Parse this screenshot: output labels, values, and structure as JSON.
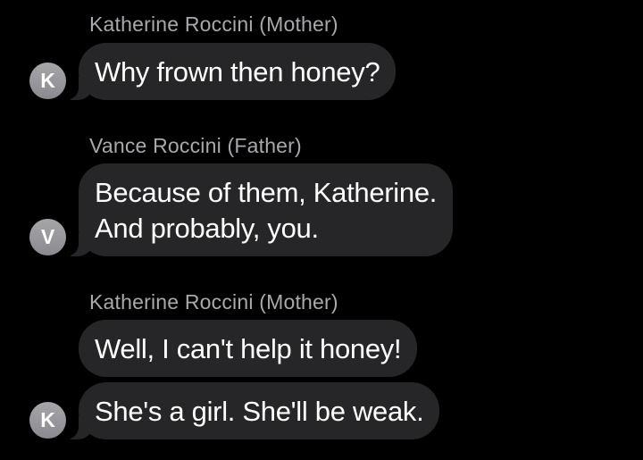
{
  "conversation": {
    "groups": [
      {
        "sender": "Katherine Roccini (Mother)",
        "avatar_initial": "K",
        "messages": [
          {
            "lines": [
              "Why frown then honey?"
            ]
          }
        ]
      },
      {
        "sender": "Vance Roccini (Father)",
        "avatar_initial": "V",
        "messages": [
          {
            "lines": [
              "Because of them, Katherine.",
              "And probably, you."
            ]
          }
        ]
      },
      {
        "sender": "Katherine Roccini (Mother)",
        "avatar_initial": "K",
        "messages": [
          {
            "lines": [
              "Well, I can't help it honey!"
            ]
          },
          {
            "lines": [
              "She's a girl. She'll be weak."
            ]
          }
        ]
      }
    ]
  },
  "colors": {
    "background": "#000000",
    "bubble": "#262629",
    "sender_name": "#a8a8ad",
    "avatar": "#9a9aa0",
    "message_text": "#ffffff"
  }
}
